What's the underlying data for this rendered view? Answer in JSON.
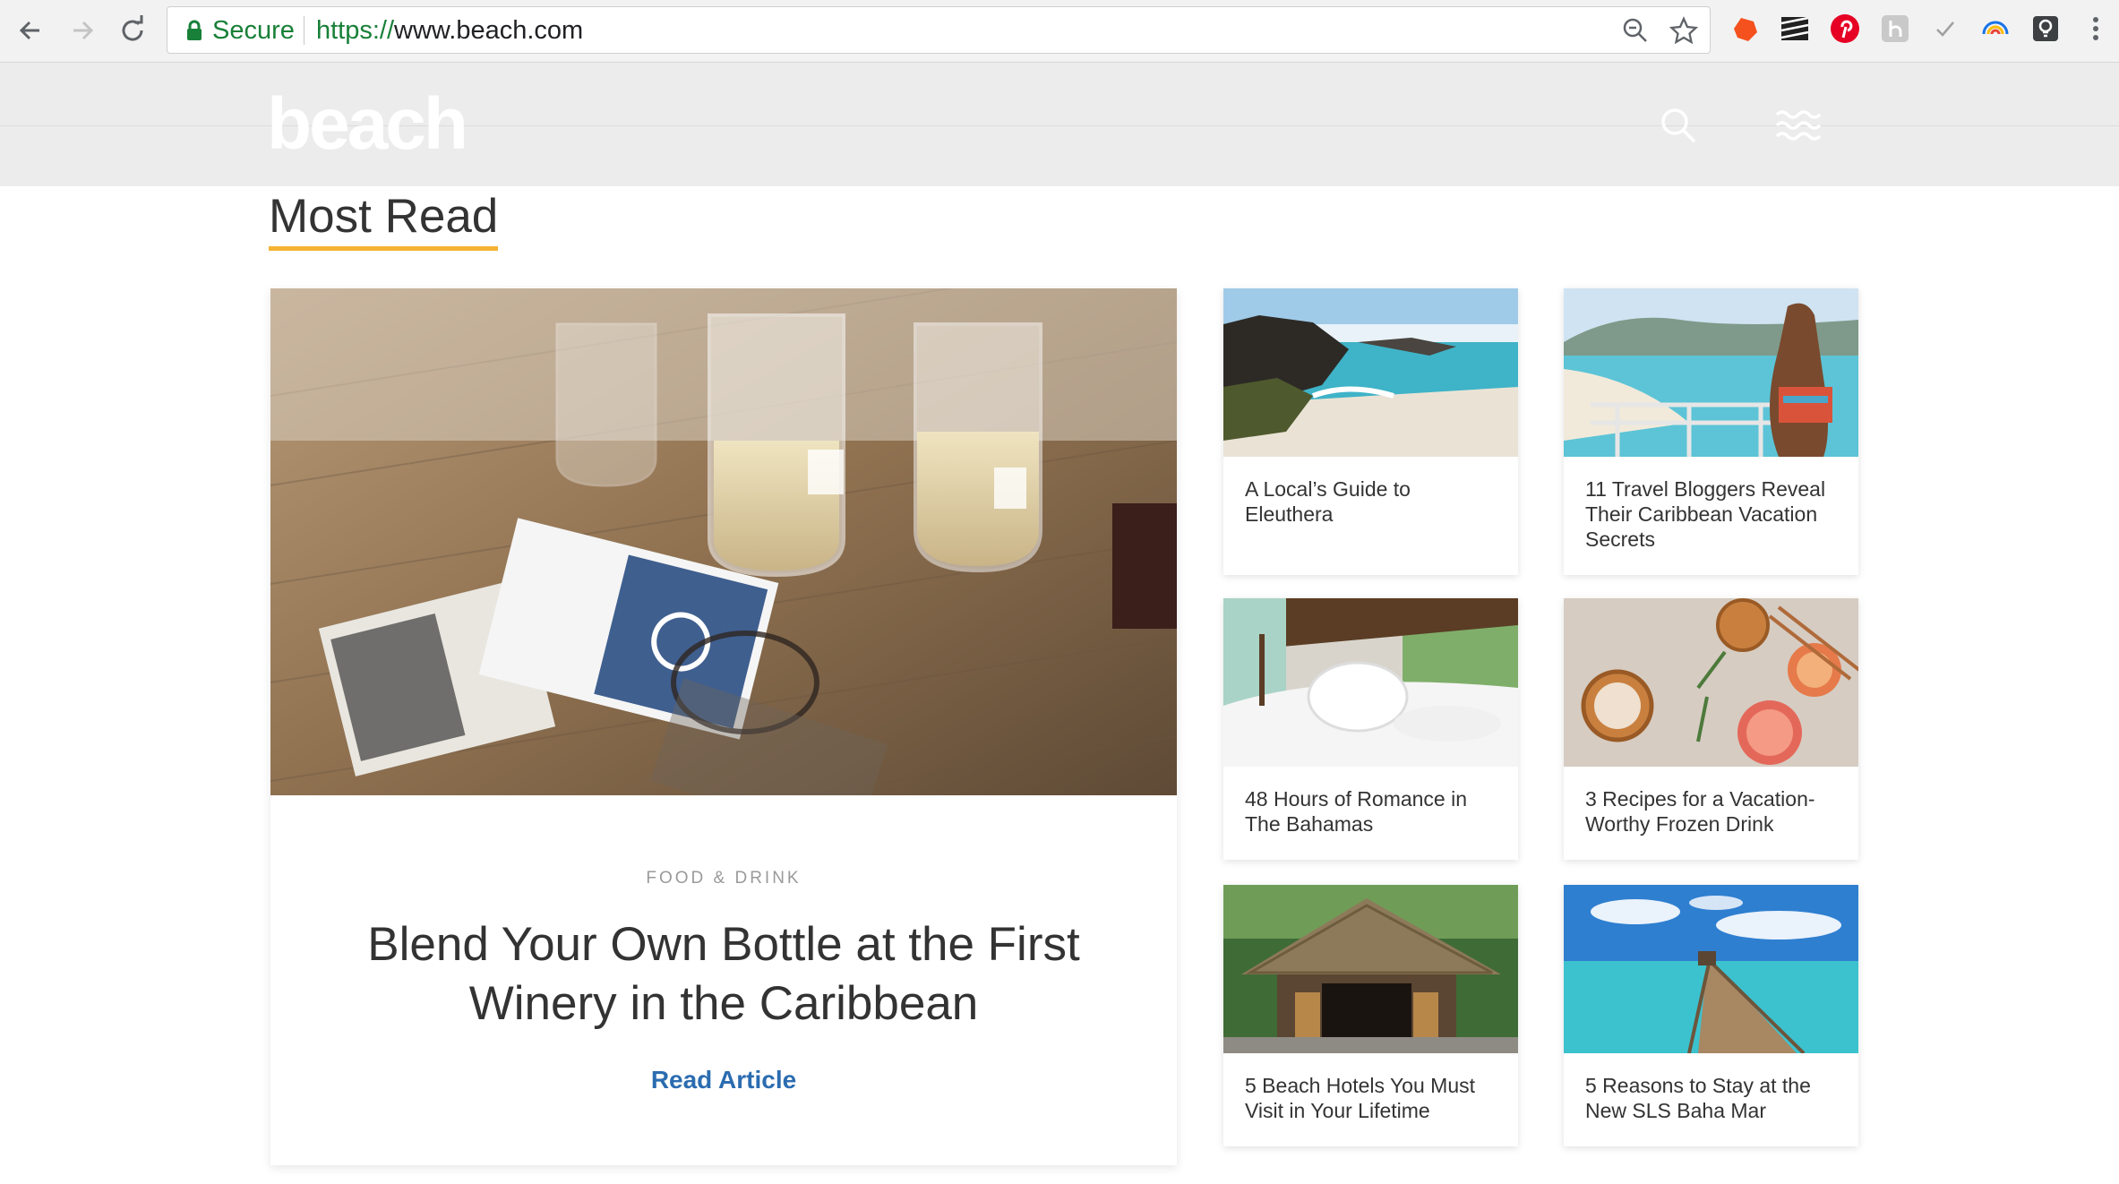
{
  "browser": {
    "secure_label": "Secure",
    "url_scheme": "https://",
    "url_host": "www.beach.com"
  },
  "site": {
    "logo": "beach"
  },
  "section": {
    "title": "Most Read"
  },
  "featured": {
    "category": "FOOD & DRINK",
    "title": "Blend Your Own Bottle at the First Winery in the Caribbean",
    "link": "Read Article"
  },
  "articles": [
    {
      "title": "A Local’s Guide to Eleuthera"
    },
    {
      "title": "11 Travel Bloggers Reveal Their Caribbean Vacation Secrets"
    },
    {
      "title": "48 Hours of Romance in The Bahamas"
    },
    {
      "title": "3 Recipes for a Vacation-Worthy Frozen Drink"
    },
    {
      "title": "5 Beach Hotels You Must Visit in Your Lifetime"
    },
    {
      "title": "5 Reasons to Stay at the New SLS Baha Mar"
    }
  ],
  "colors": {
    "accent_underline": "#f5b335",
    "link_blue": "#2b6cb0",
    "secure_green": "#188038",
    "header_bg": "#ececec"
  }
}
